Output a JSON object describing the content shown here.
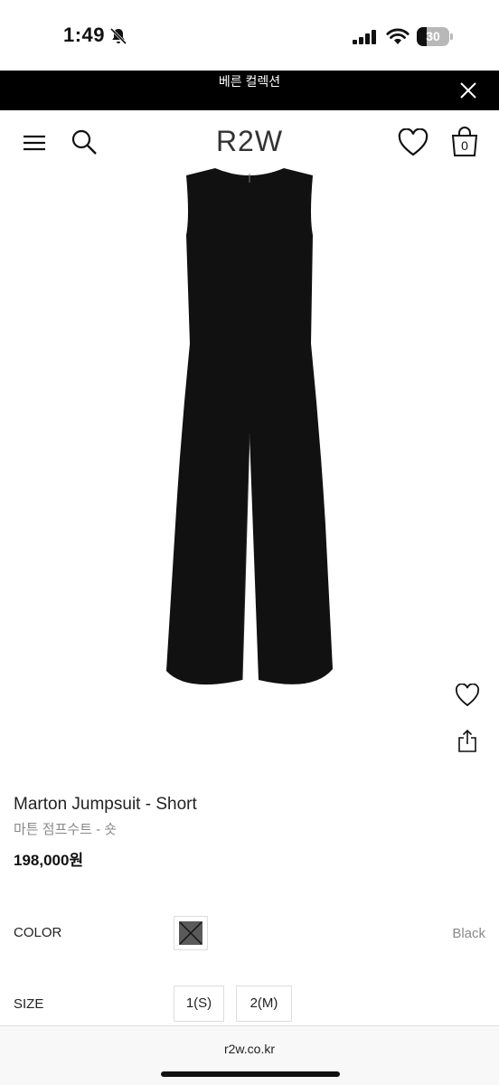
{
  "status_bar": {
    "time": "1:49",
    "battery_level": "30",
    "battery_fraction": 0.3
  },
  "banner": {
    "text": "베른 컬렉션"
  },
  "header": {
    "logo": "R2W",
    "cart_count": "0"
  },
  "product": {
    "name": "Marton Jumpsuit - Short",
    "name_ko": "마튼 점프수트 - 숏",
    "price": "198,000원",
    "image_subject": "black sleeveless wide-leg jumpsuit"
  },
  "options": {
    "color_label": "COLOR",
    "color_value": "Black",
    "size_label": "SIZE",
    "sizes": [
      "1(S)",
      "2(M)"
    ]
  },
  "browser": {
    "url": "r2w.co.kr"
  },
  "icons": [
    "bell-slash-icon",
    "signal-icon",
    "wifi-icon",
    "battery-icon",
    "close-icon",
    "menu-icon",
    "search-icon",
    "heart-icon",
    "shopping-bag-icon",
    "share-icon"
  ],
  "colors": {
    "banner_bg": "#000000",
    "image_bg": "#efefef",
    "garment": "#111111",
    "muted_text": "#888888"
  }
}
